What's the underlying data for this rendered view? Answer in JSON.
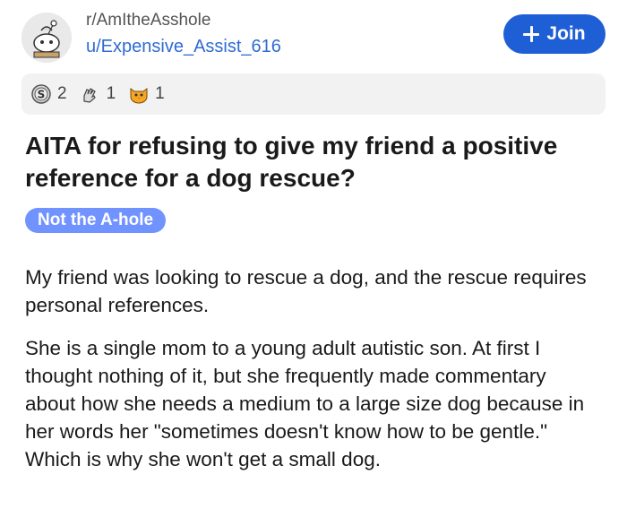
{
  "post": {
    "subreddit": "r/AmItheAsshole",
    "author": "u/Expensive_Assist_616",
    "join_label": "Join",
    "awards": [
      {
        "icon": "silver-award-icon",
        "count": "2"
      },
      {
        "icon": "hand-award-icon",
        "count": "1"
      },
      {
        "icon": "cat-award-icon",
        "count": "1"
      }
    ],
    "title": "AITA for refusing to give my friend a positive reference for a dog rescue?",
    "flair": "Not the A-hole",
    "paragraphs": [
      "My friend was looking to rescue a dog, and the rescue requires personal references.",
      "She is a single mom to a young adult autistic son. At first I thought nothing of it, but she frequently made commentary about how she needs a medium to a large size dog because in her words her \"sometimes doesn't know how to be gentle.\" Which is why she won't get a small dog."
    ]
  },
  "colors": {
    "join_button": "#1f5fd6",
    "flair_bg": "#7193ff",
    "author_link": "#2f6bd3",
    "award_strip": "#f2f2f3"
  }
}
